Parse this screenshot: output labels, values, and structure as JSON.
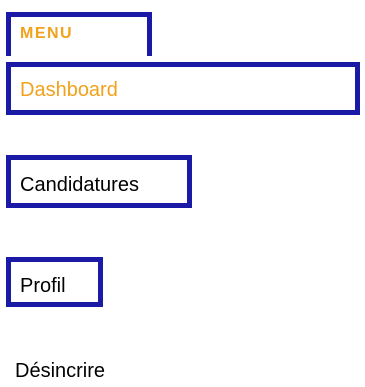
{
  "menu": {
    "heading": "MENU",
    "accent_color": "#f0a21c",
    "outline_color": "#1a1aa6",
    "items": [
      {
        "label": "Dashboard",
        "active": true
      },
      {
        "label": "Candidatures",
        "active": false
      },
      {
        "label": "Profil",
        "active": false
      },
      {
        "label": "Désincrire",
        "active": false
      }
    ]
  }
}
